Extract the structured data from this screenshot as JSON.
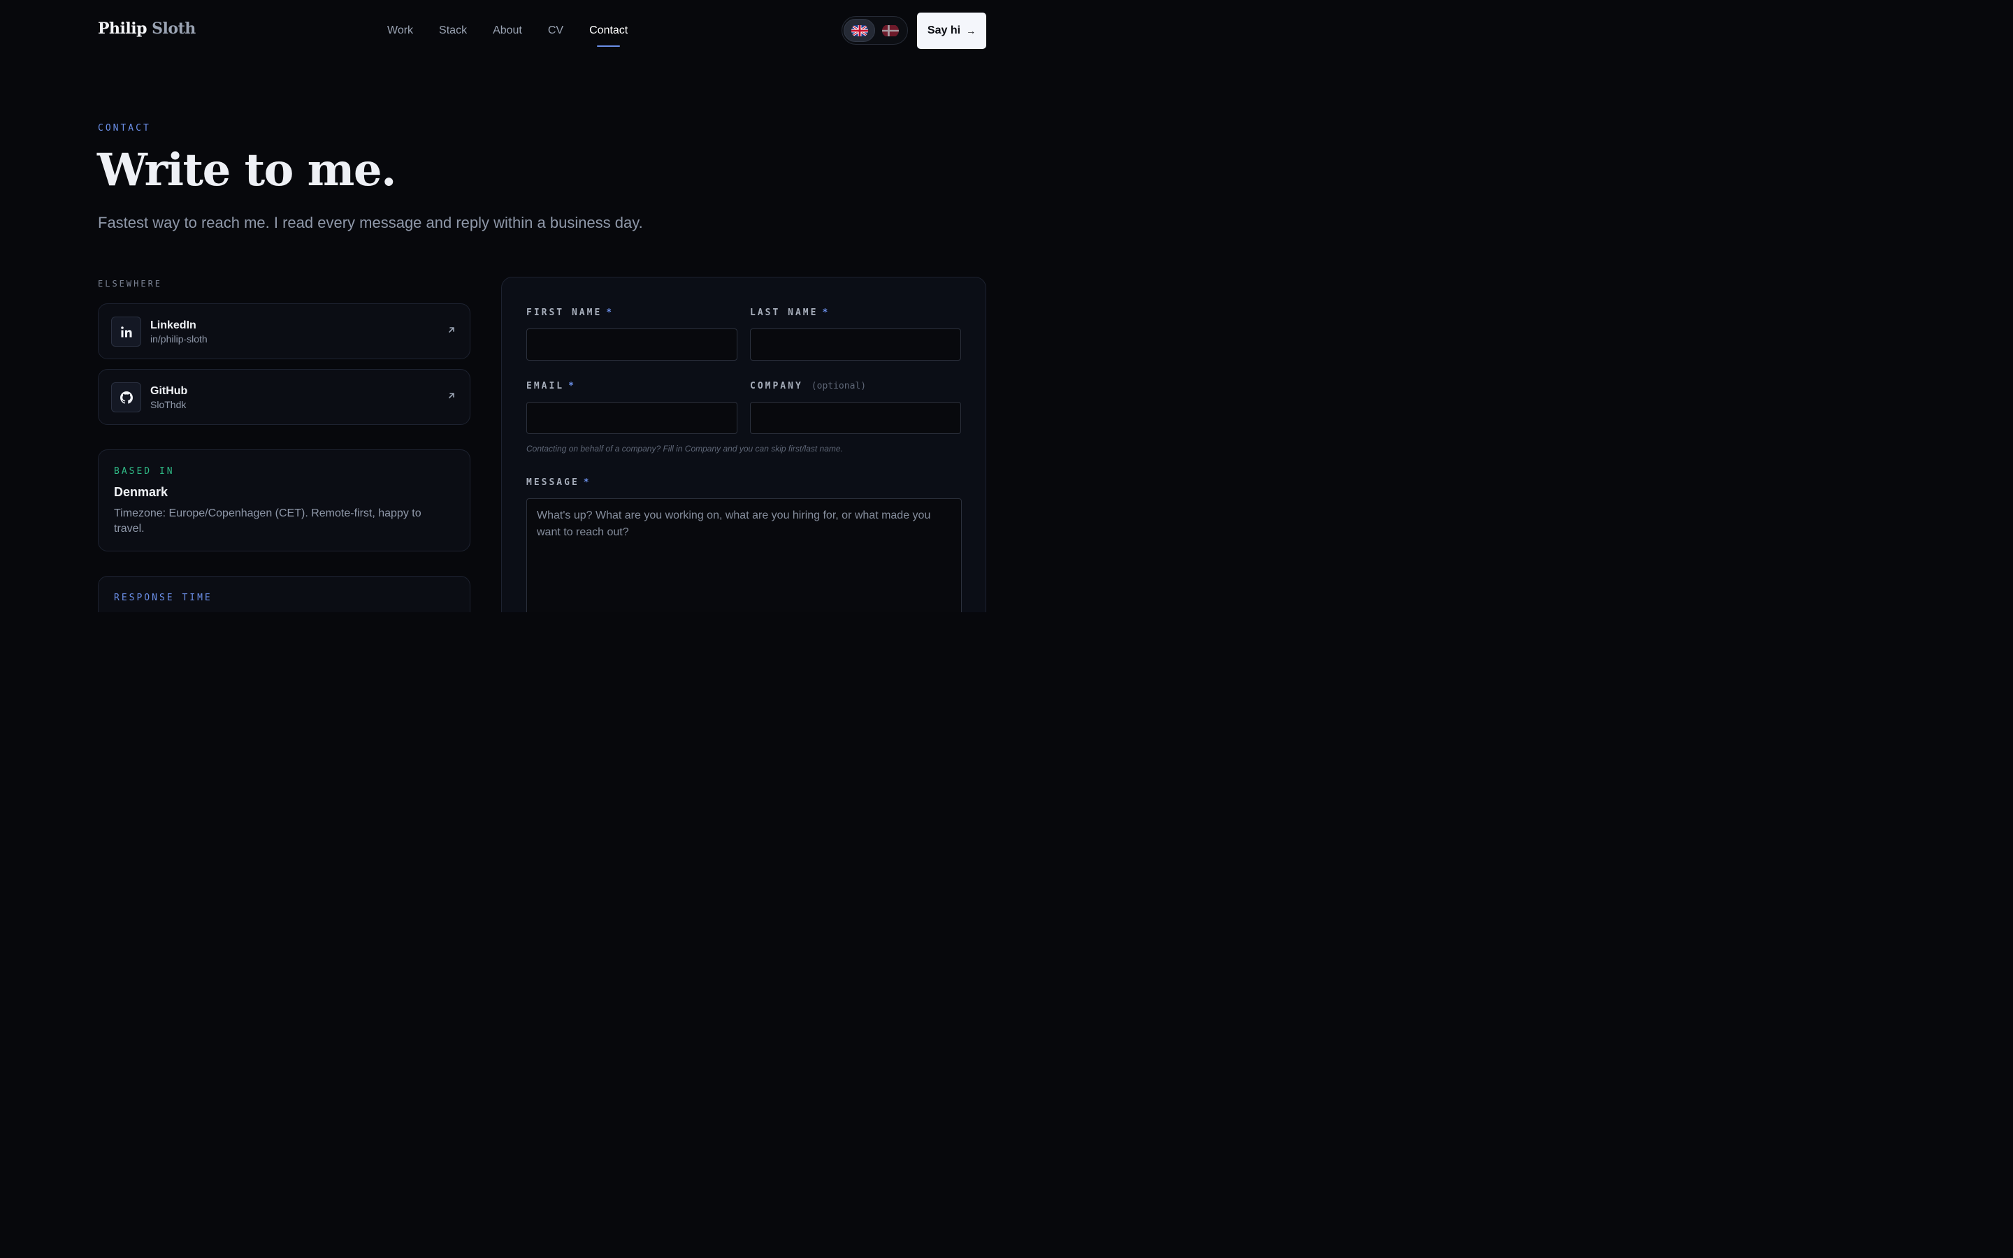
{
  "header": {
    "logo_first": "Philip",
    "logo_last": "Sloth",
    "nav": [
      {
        "label": "Work"
      },
      {
        "label": "Stack"
      },
      {
        "label": "About"
      },
      {
        "label": "CV"
      },
      {
        "label": "Contact",
        "active": true
      }
    ],
    "languages": [
      {
        "code": "en",
        "icon": "uk-flag-icon",
        "active": true
      },
      {
        "code": "da",
        "icon": "denmark-flag-icon",
        "active": false
      }
    ],
    "cta_label": "Say hi",
    "cta_arrow": "→"
  },
  "hero": {
    "eyebrow": "CONTACT",
    "title": "Write to me.",
    "subtitle": "Fastest way to reach me. I read every message and reply within a business day."
  },
  "elsewhere": {
    "label": "ELSEWHERE",
    "links": [
      {
        "name": "LinkedIn",
        "handle": "in/philip-sloth",
        "icon": "linkedin-icon"
      },
      {
        "name": "GitHub",
        "handle": "SloThdk",
        "icon": "github-icon"
      }
    ]
  },
  "based_in": {
    "eyebrow": "BASED IN",
    "heading": "Denmark",
    "body": "Timezone: Europe/Copenhagen (CET). Remote-first, happy to travel."
  },
  "response_time": {
    "eyebrow": "RESPONSE TIME"
  },
  "form": {
    "first_name_label": "FIRST NAME",
    "last_name_label": "LAST NAME",
    "email_label": "EMAIL",
    "company_label": "COMPANY",
    "optional_label": "(optional)",
    "required_mark": "*",
    "first_name_value": "",
    "last_name_value": "",
    "email_value": "",
    "company_value": "",
    "hint": "Contacting on behalf of a company? Fill in Company and you can skip first/last name.",
    "message_label": "MESSAGE",
    "message_placeholder": "What's up? What are you working on, what are you hiring for, or what made you want to reach out?"
  },
  "colors": {
    "background": "#07080c",
    "accent": "#6b8fe8",
    "based_in_accent": "#2fb985",
    "text_muted": "#8f98a9"
  }
}
